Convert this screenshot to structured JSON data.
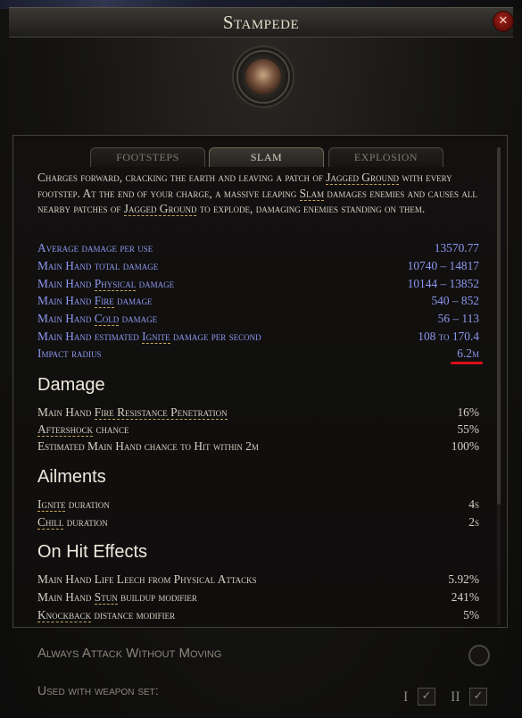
{
  "window": {
    "title": "Stampede",
    "close_glyph": "✕"
  },
  "tabs": [
    {
      "label": "Footsteps",
      "active": false
    },
    {
      "label": "Slam",
      "active": true
    },
    {
      "label": "Explosion",
      "active": false
    }
  ],
  "description": {
    "p1": "Charges forward, cracking the earth and leaving a patch of ",
    "k1": "Jagged Ground",
    "p2": " with every footstep. At the end of your charge, a massive leaping ",
    "k2": "Slam",
    "p3": " damages enemies and causes all nearby patches of ",
    "k3": "Jagged Ground",
    "p4": " to explode, damaging enemies standing on them."
  },
  "main_stats": [
    {
      "label": "Average damage per use",
      "value": "13570.77"
    },
    {
      "label": "Main Hand total damage",
      "value": "10740 – 14817"
    },
    {
      "label_pre": "Main Hand ",
      "label_key": "Physical",
      "label_post": " damage",
      "value": "10144 – 13852"
    },
    {
      "label_pre": "Main Hand ",
      "label_key": "Fire",
      "label_post": " damage",
      "value": "540 – 852"
    },
    {
      "label_pre": "Main Hand ",
      "label_key": "Cold",
      "label_post": " damage",
      "value": "56 – 113"
    },
    {
      "label_pre": "Main Hand estimated ",
      "label_key": "Ignite",
      "label_post": " damage per second",
      "value": "108 to 170.4"
    },
    {
      "label": "Impact radius",
      "value": "6.2m"
    }
  ],
  "damage_section": {
    "title": "Damage",
    "stats": [
      {
        "label_pre": "Main Hand ",
        "label_key": "Fire Resistance Penetration",
        "label_post": "",
        "value": "16%"
      },
      {
        "label_pre": "",
        "label_key": "Aftershock",
        "label_post": " chance",
        "value": "55%"
      },
      {
        "label": "Estimated Main Hand chance to Hit within 2m",
        "value": "100%"
      }
    ]
  },
  "ailments_section": {
    "title": "Ailments",
    "stats": [
      {
        "label_key": "Ignite",
        "label_post": " duration",
        "value": "4s"
      },
      {
        "label_key": "Chill",
        "label_post": " duration",
        "value": "2s"
      }
    ]
  },
  "onhit_section": {
    "title": "On Hit Effects",
    "stats": [
      {
        "label": "Main Hand Life Leech from Physical Attacks",
        "value": "5.92%"
      },
      {
        "label_pre": "Main Hand ",
        "label_key": "Stun",
        "label_post": " buildup modifier",
        "value": "241%"
      },
      {
        "label_key": "Knockback",
        "label_post": " distance modifier",
        "value": "5%"
      }
    ]
  },
  "options": {
    "always_attack_label": "Always Attack Without Moving",
    "weapon_set_label": "Used with weapon set:",
    "weapon_set_1": "I",
    "weapon_set_2": "II",
    "check_glyph": "✓"
  },
  "colors": {
    "stat_blue": "#8c98ef",
    "highlight_red": "#d9101a",
    "keyword_underline": "#c9a65a"
  }
}
